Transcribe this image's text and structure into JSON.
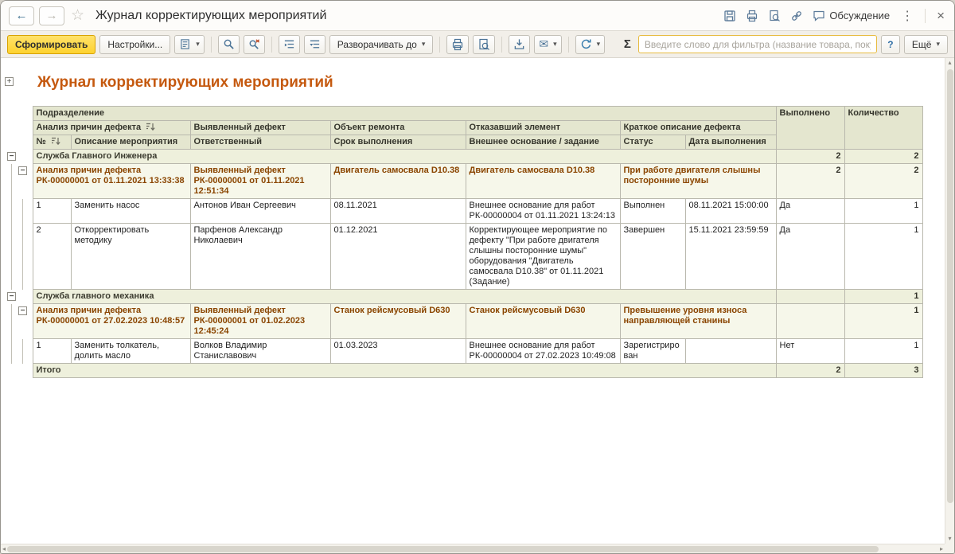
{
  "titlebar": {
    "title": "Журнал корректирующих мероприятий",
    "discussion": "Обсуждение"
  },
  "icons": {
    "back": "←",
    "forward": "→",
    "star": "☆",
    "kebab": "⋮",
    "close": "×",
    "sigma": "Σ",
    "dropdown": "▾",
    "envelope": "✉",
    "help": "?",
    "plus": "+",
    "minus": "−",
    "scroll_up": "▴",
    "scroll_down": "▾",
    "scroll_left": "◂",
    "scroll_right": "▸"
  },
  "toolbar": {
    "generate": "Сформировать",
    "settings": "Настройки...",
    "expand_to": "Разворачивать до",
    "filter_placeholder": "Введите слово для фильтра (название товара, покупателя...",
    "more": "Ещё"
  },
  "report": {
    "title": "Журнал корректирующих мероприятий",
    "columns": {
      "department": "Подразделение",
      "analysis": "Анализ причин дефекта",
      "defect": "Выявленный дефект",
      "repair_object": "Объект ремонта",
      "failed_element": "Отказавший элемент",
      "short_description": "Краткое описание дефекта",
      "done": "Выполнено",
      "qty": "Количество",
      "num": "№",
      "action": "Описание мероприятия",
      "responsible": "Ответственный",
      "deadline": "Срок выполнения",
      "basis": "Внешнее основание / задание",
      "status": "Статус",
      "done_date": "Дата выполнения"
    },
    "groups": [
      {
        "name": "Служба Главного Инженера",
        "done": "2",
        "qty": "2",
        "details": [
          {
            "analysis": "Анализ причин дефекта РК-00000001 от 01.11.2021 13:33:38",
            "defect": "Выявленный дефект РК-00000001 от 01.11.2021 12:51:34",
            "repair_object": "Двигатель самосвала D10.38",
            "failed_element": "Двигатель самосвала D10.38",
            "description": "При работе двигателя слышны посторонние шумы",
            "done": "2",
            "qty": "2",
            "rows": [
              {
                "num": "1",
                "action": "Заменить насос",
                "responsible": "Антонов Иван Сергеевич",
                "deadline": "08.11.2021",
                "basis": "Внешнее основание для работ РК-00000004 от 01.11.2021 13:24:13",
                "status": "Выполнен",
                "done_date": "08.11.2021 15:00:00",
                "done": "Да",
                "qty": "1"
              },
              {
                "num": "2",
                "action": "Откорректировать методику",
                "responsible": "Парфенов Александр Николаевич",
                "deadline": "01.12.2021",
                "basis": "Корректирующее мероприятие по дефекту \"При работе двигателя слышны посторонние шумы\" оборудования \"Двигатель самосвала D10.38\" от 01.11.2021 (Задание)",
                "status": "Завершен",
                "done_date": "15.11.2021 23:59:59",
                "done": "Да",
                "qty": "1"
              }
            ]
          }
        ]
      },
      {
        "name": "Служба главного механика",
        "done": "",
        "qty": "1",
        "details": [
          {
            "analysis": "Анализ причин дефекта РК-00000001 от 27.02.2023 10:48:57",
            "defect": "Выявленный дефект РК-00000001 от 01.02.2023 12:45:24",
            "repair_object": "Станок рейсмусовый D630",
            "failed_element": "Станок рейсмусовый D630",
            "description": "Превышение уровня износа направляющей станины",
            "done": "",
            "qty": "1",
            "rows": [
              {
                "num": "1",
                "action": "Заменить толкатель, долить масло",
                "responsible": "Волков Владимир Станиславович",
                "deadline": "01.03.2023",
                "basis": "Внешнее основание для работ РК-00000004 от 27.02.2023 10:49:08",
                "status": "Зарегистрирован",
                "done_date": "",
                "done": "Нет",
                "qty": "1"
              }
            ]
          }
        ]
      }
    ],
    "total": {
      "label": "Итого",
      "done": "2",
      "qty": "3"
    }
  }
}
